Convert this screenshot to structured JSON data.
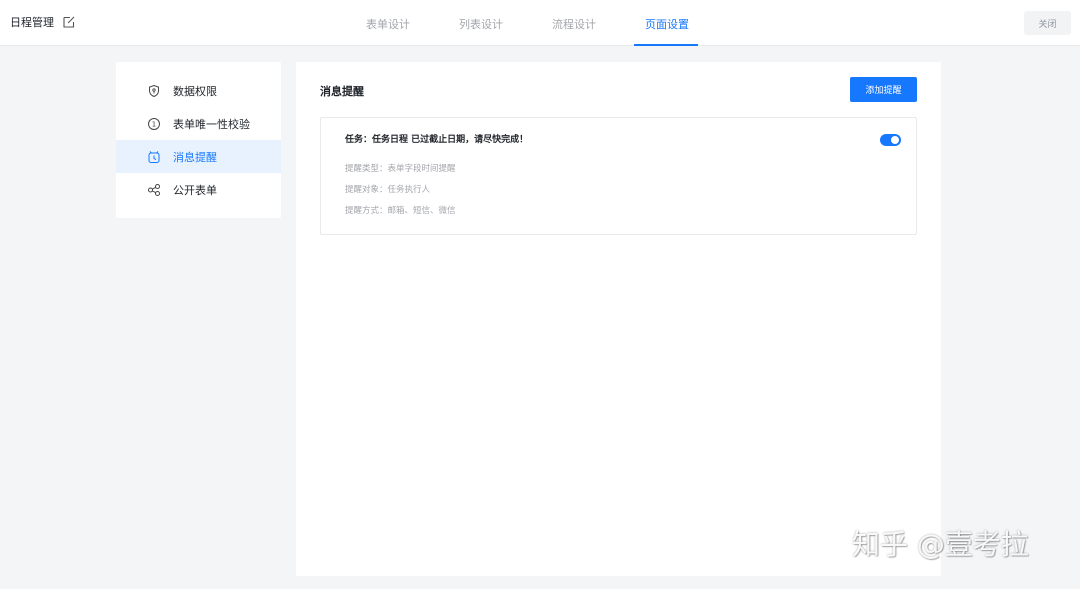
{
  "header": {
    "app_title": "日程管理",
    "tabs": [
      {
        "label": "表单设计",
        "active": false
      },
      {
        "label": "列表设计",
        "active": false
      },
      {
        "label": "流程设计",
        "active": false
      },
      {
        "label": "页面设置",
        "active": true
      }
    ],
    "close_label": "关闭"
  },
  "sidebar": {
    "items": [
      {
        "label": "数据权限",
        "icon": "shield-icon",
        "active": false
      },
      {
        "label": "表单唯一性校验",
        "icon": "unique-check-icon",
        "active": false
      },
      {
        "label": "消息提醒",
        "icon": "alarm-clock-icon",
        "active": true
      },
      {
        "label": "公开表单",
        "icon": "share-icon",
        "active": false
      }
    ]
  },
  "main": {
    "title": "消息提醒",
    "add_button_label": "添加提醒",
    "reminder": {
      "title": "任务：任务日程 已过截止日期，请尽快完成！",
      "type_line": "提醒类型：表单字段时间提醒",
      "target_line": "提醒对象：任务执行人",
      "method_line": "提醒方式：邮箱、短信、微信",
      "enabled": true
    }
  },
  "watermark": "知乎 @壹考拉",
  "colors": {
    "accent": "#1677ff",
    "active_bg": "#e8f2ff",
    "page_bg": "#f4f5f7"
  }
}
